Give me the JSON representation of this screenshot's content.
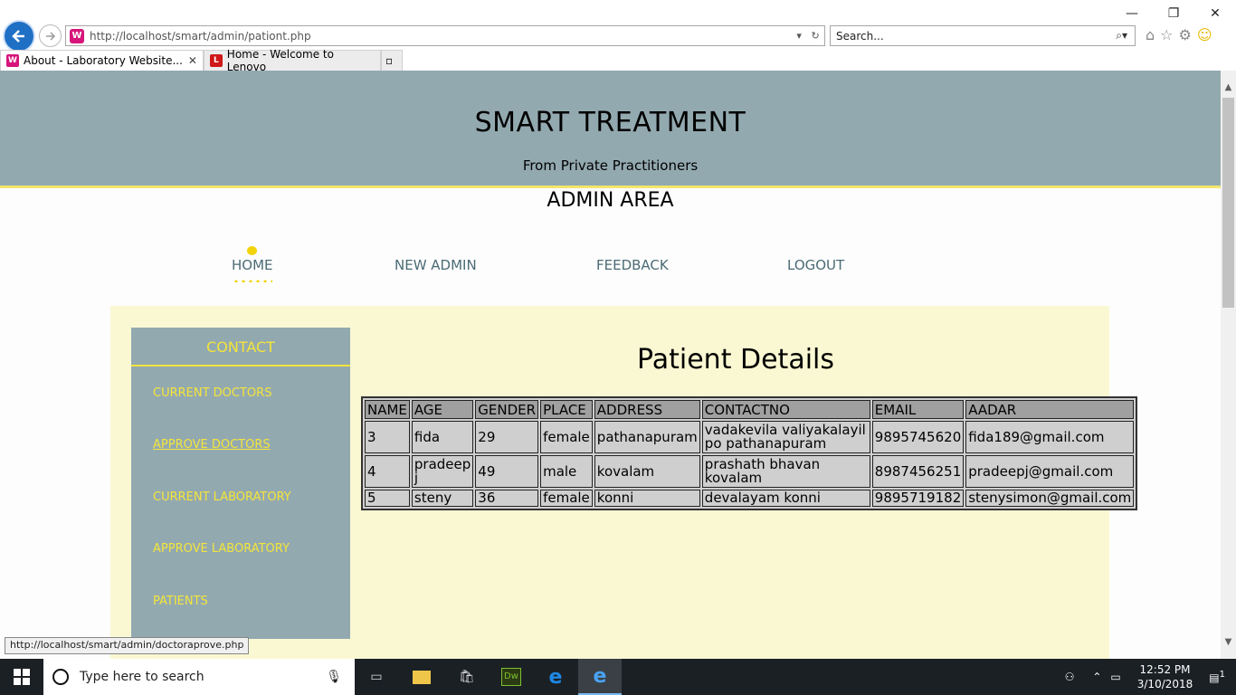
{
  "browser": {
    "url": "http://localhost/smart/admin/pationt.php",
    "search_placeholder": "Search...",
    "tabs": [
      {
        "label": "About - Laboratory Website...",
        "icon": "wamp-icon",
        "active": true
      },
      {
        "label": "Home - Welcome to Lenovo",
        "icon": "lenovo-icon",
        "active": false
      }
    ],
    "status_url": "http://localhost/smart/admin/doctoraprove.php"
  },
  "site": {
    "title": "SMART TREATMENT",
    "subtitle": "From Private Practitioners",
    "area": "ADMIN AREA"
  },
  "nav": {
    "home": "HOME",
    "new_admin": "NEW ADMIN",
    "feedback": "FEEDBACK",
    "logout": "LOGOUT"
  },
  "sidebar": {
    "title": "CONTACT",
    "items": [
      {
        "label": "CURRENT DOCTORS"
      },
      {
        "label": "APPROVE DOCTORS"
      },
      {
        "label": "CURRENT LABORATORY"
      },
      {
        "label": "APPROVE LABORATORY"
      },
      {
        "label": "PATIENTS"
      }
    ]
  },
  "main": {
    "heading": "Patient Details",
    "columns": [
      "NAME",
      "AGE",
      "GENDER",
      "PLACE",
      "ADDRESS",
      "CONTACTNO",
      "EMAIL",
      "AADAR"
    ],
    "rows": [
      [
        "3",
        "fida",
        "29",
        "female",
        "pathanapuram",
        "vadakevila valiyakalayil po pathanapuram",
        "9895745620",
        "fida189@gmail.com"
      ],
      [
        "4",
        "pradeep j",
        "49",
        "male",
        "kovalam",
        "prashath bhavan kovalam",
        "8987456251",
        "pradeepj@gmail.com"
      ],
      [
        "5",
        "steny",
        "36",
        "female",
        "konni",
        "devalayam konni",
        "9895719182",
        "stenysimon@gmail.com"
      ]
    ]
  },
  "taskbar": {
    "search_placeholder": "Type here to search",
    "time": "12:52 PM",
    "date": "3/10/2018",
    "notification_count": "1"
  },
  "colors": {
    "header_bg": "#93a9b0",
    "accent_yellow": "#f3e53b",
    "content_bg": "#f9f8d2",
    "nav_text": "#4b6b75"
  }
}
